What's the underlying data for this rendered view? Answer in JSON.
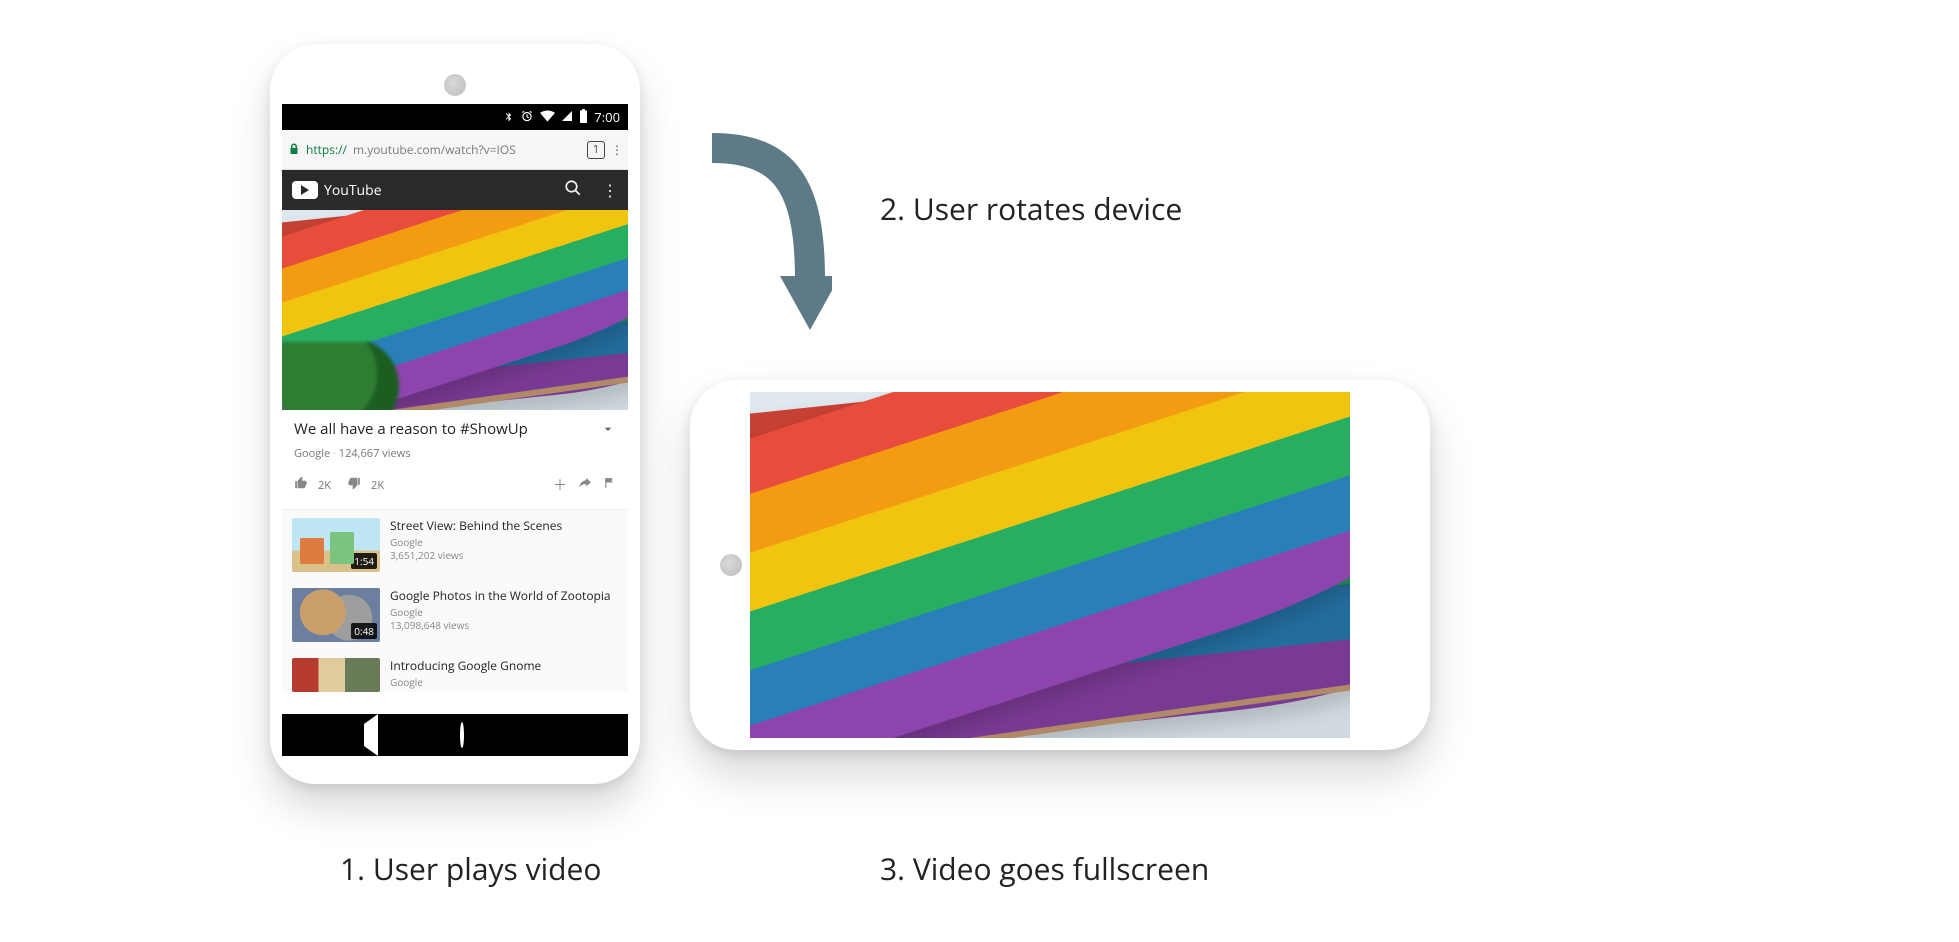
{
  "diagram": {
    "caption_step1": "1. User plays video",
    "caption_step2": "2. User rotates device",
    "caption_step3": "3. Video goes fullscreen"
  },
  "status_bar": {
    "time": "7:00",
    "icons": {
      "bluetooth": "bluetooth-icon",
      "alarm": "alarm-icon",
      "wifi": "wifi-icon",
      "cell": "cell-signal-icon",
      "battery": "battery-icon"
    }
  },
  "browser": {
    "url_scheme": "https://",
    "url_host_path": "m.youtube.com/watch?v=IOS",
    "tab_count": "1"
  },
  "youtube": {
    "brand": "YouTube",
    "video": {
      "title": "We all have a reason to #ShowUp",
      "channel": "Google",
      "views": "124,667 views",
      "likes": "2K",
      "dislikes": "2K"
    },
    "suggestions": [
      {
        "title": "Street View: Behind the Scenes",
        "channel": "Google",
        "views": "3,651,202 views",
        "duration": "1:54"
      },
      {
        "title": "Google Photos in the World of Zootopia",
        "channel": "Google",
        "views": "13,098,648 views",
        "duration": "0:48"
      },
      {
        "title": "Introducing Google Gnome",
        "channel": "Google",
        "views": "",
        "duration": ""
      }
    ]
  }
}
